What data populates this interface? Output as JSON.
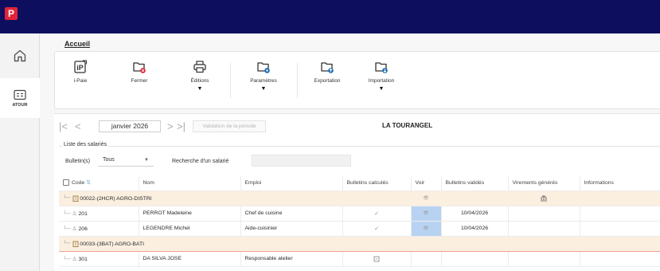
{
  "app": {
    "logo": "P",
    "brand_color": "#e0243a",
    "topbar_color": "#0d0f5e"
  },
  "leftnav": {
    "items": [
      {
        "icon": "home-icon",
        "label": ""
      },
      {
        "icon": "id-card-icon",
        "label": "ATOUR"
      }
    ]
  },
  "ribbon": {
    "tab": "Accueil",
    "buttons": [
      {
        "label": "i-Paie",
        "icon": "ipaie-icon",
        "dropdown": false
      },
      {
        "label": "Fermer",
        "icon": "folder-close-icon",
        "dropdown": false
      },
      {
        "label": "Éditions",
        "icon": "printer-icon",
        "dropdown": true
      },
      {
        "label": "Paramètres",
        "icon": "folder-settings-icon",
        "dropdown": true
      },
      {
        "label": "Exportation",
        "icon": "folder-export-icon",
        "dropdown": false
      },
      {
        "label": "Importation",
        "icon": "folder-import-icon",
        "dropdown": true
      }
    ]
  },
  "period": {
    "first": "|<",
    "prev": "<",
    "month": "janvier 2026",
    "next": ">",
    "last": ">|",
    "validate_label": "Validation de la période",
    "company": "LA TOURANGEL"
  },
  "employees": {
    "section_title": "Liste des salariés",
    "filter_label": "Bulletin(s)",
    "filter_value": "Tous",
    "search_label": "Recherche d'un salarié",
    "search_value": "",
    "columns": {
      "code": "Code",
      "nom": "Nom",
      "emploi": "Emploi",
      "bulletins_calcules": "Bulletins calculés",
      "voir": "Voir",
      "bulletins_valides": "Bulletins validés",
      "virements": "Virements générés",
      "informations": "Informations"
    },
    "groups": [
      {
        "label": "00022-(2HCR) AGRO-DISTRI",
        "rows": [
          {
            "code": "201",
            "nom": "PERROT Madeleine",
            "emploi": "Chef de cuisine",
            "calcule": "✓",
            "valide": "10/04/2026"
          },
          {
            "code": "206",
            "nom": "LEGENDRE Michel",
            "emploi": "Aide-cuisinier",
            "calcule": "✓",
            "valide": "10/04/2026"
          }
        ]
      },
      {
        "label": "00033-(3BAT) AGRO-BATI",
        "rows": [
          {
            "code": "301",
            "nom": "DA SILVA JOSE",
            "emploi": "Responsable atelier",
            "calcule": "",
            "valide": ""
          }
        ]
      }
    ]
  }
}
